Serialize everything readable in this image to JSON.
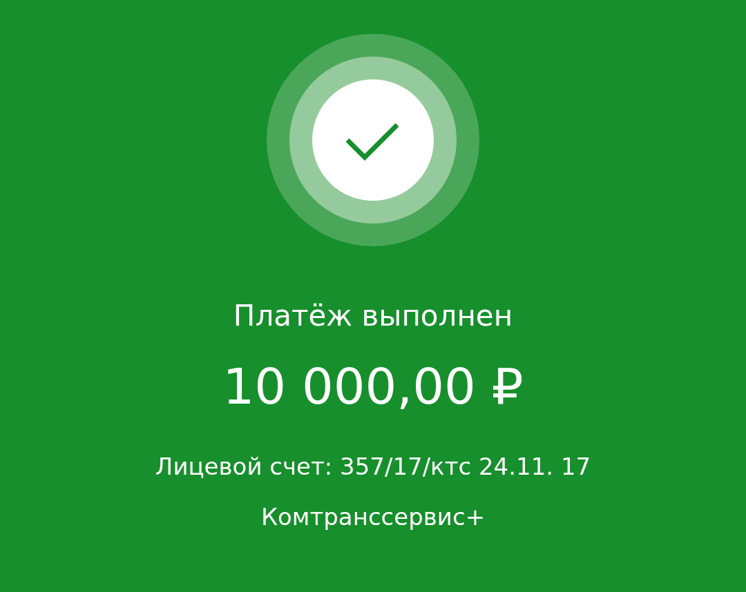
{
  "status": {
    "title": "Платёж выполнен",
    "amount": "10 000,00 ₽",
    "account": "Лицевой счет: 357/17/ктс 24.11. 17",
    "recipient": "Комтранссервис+"
  }
}
